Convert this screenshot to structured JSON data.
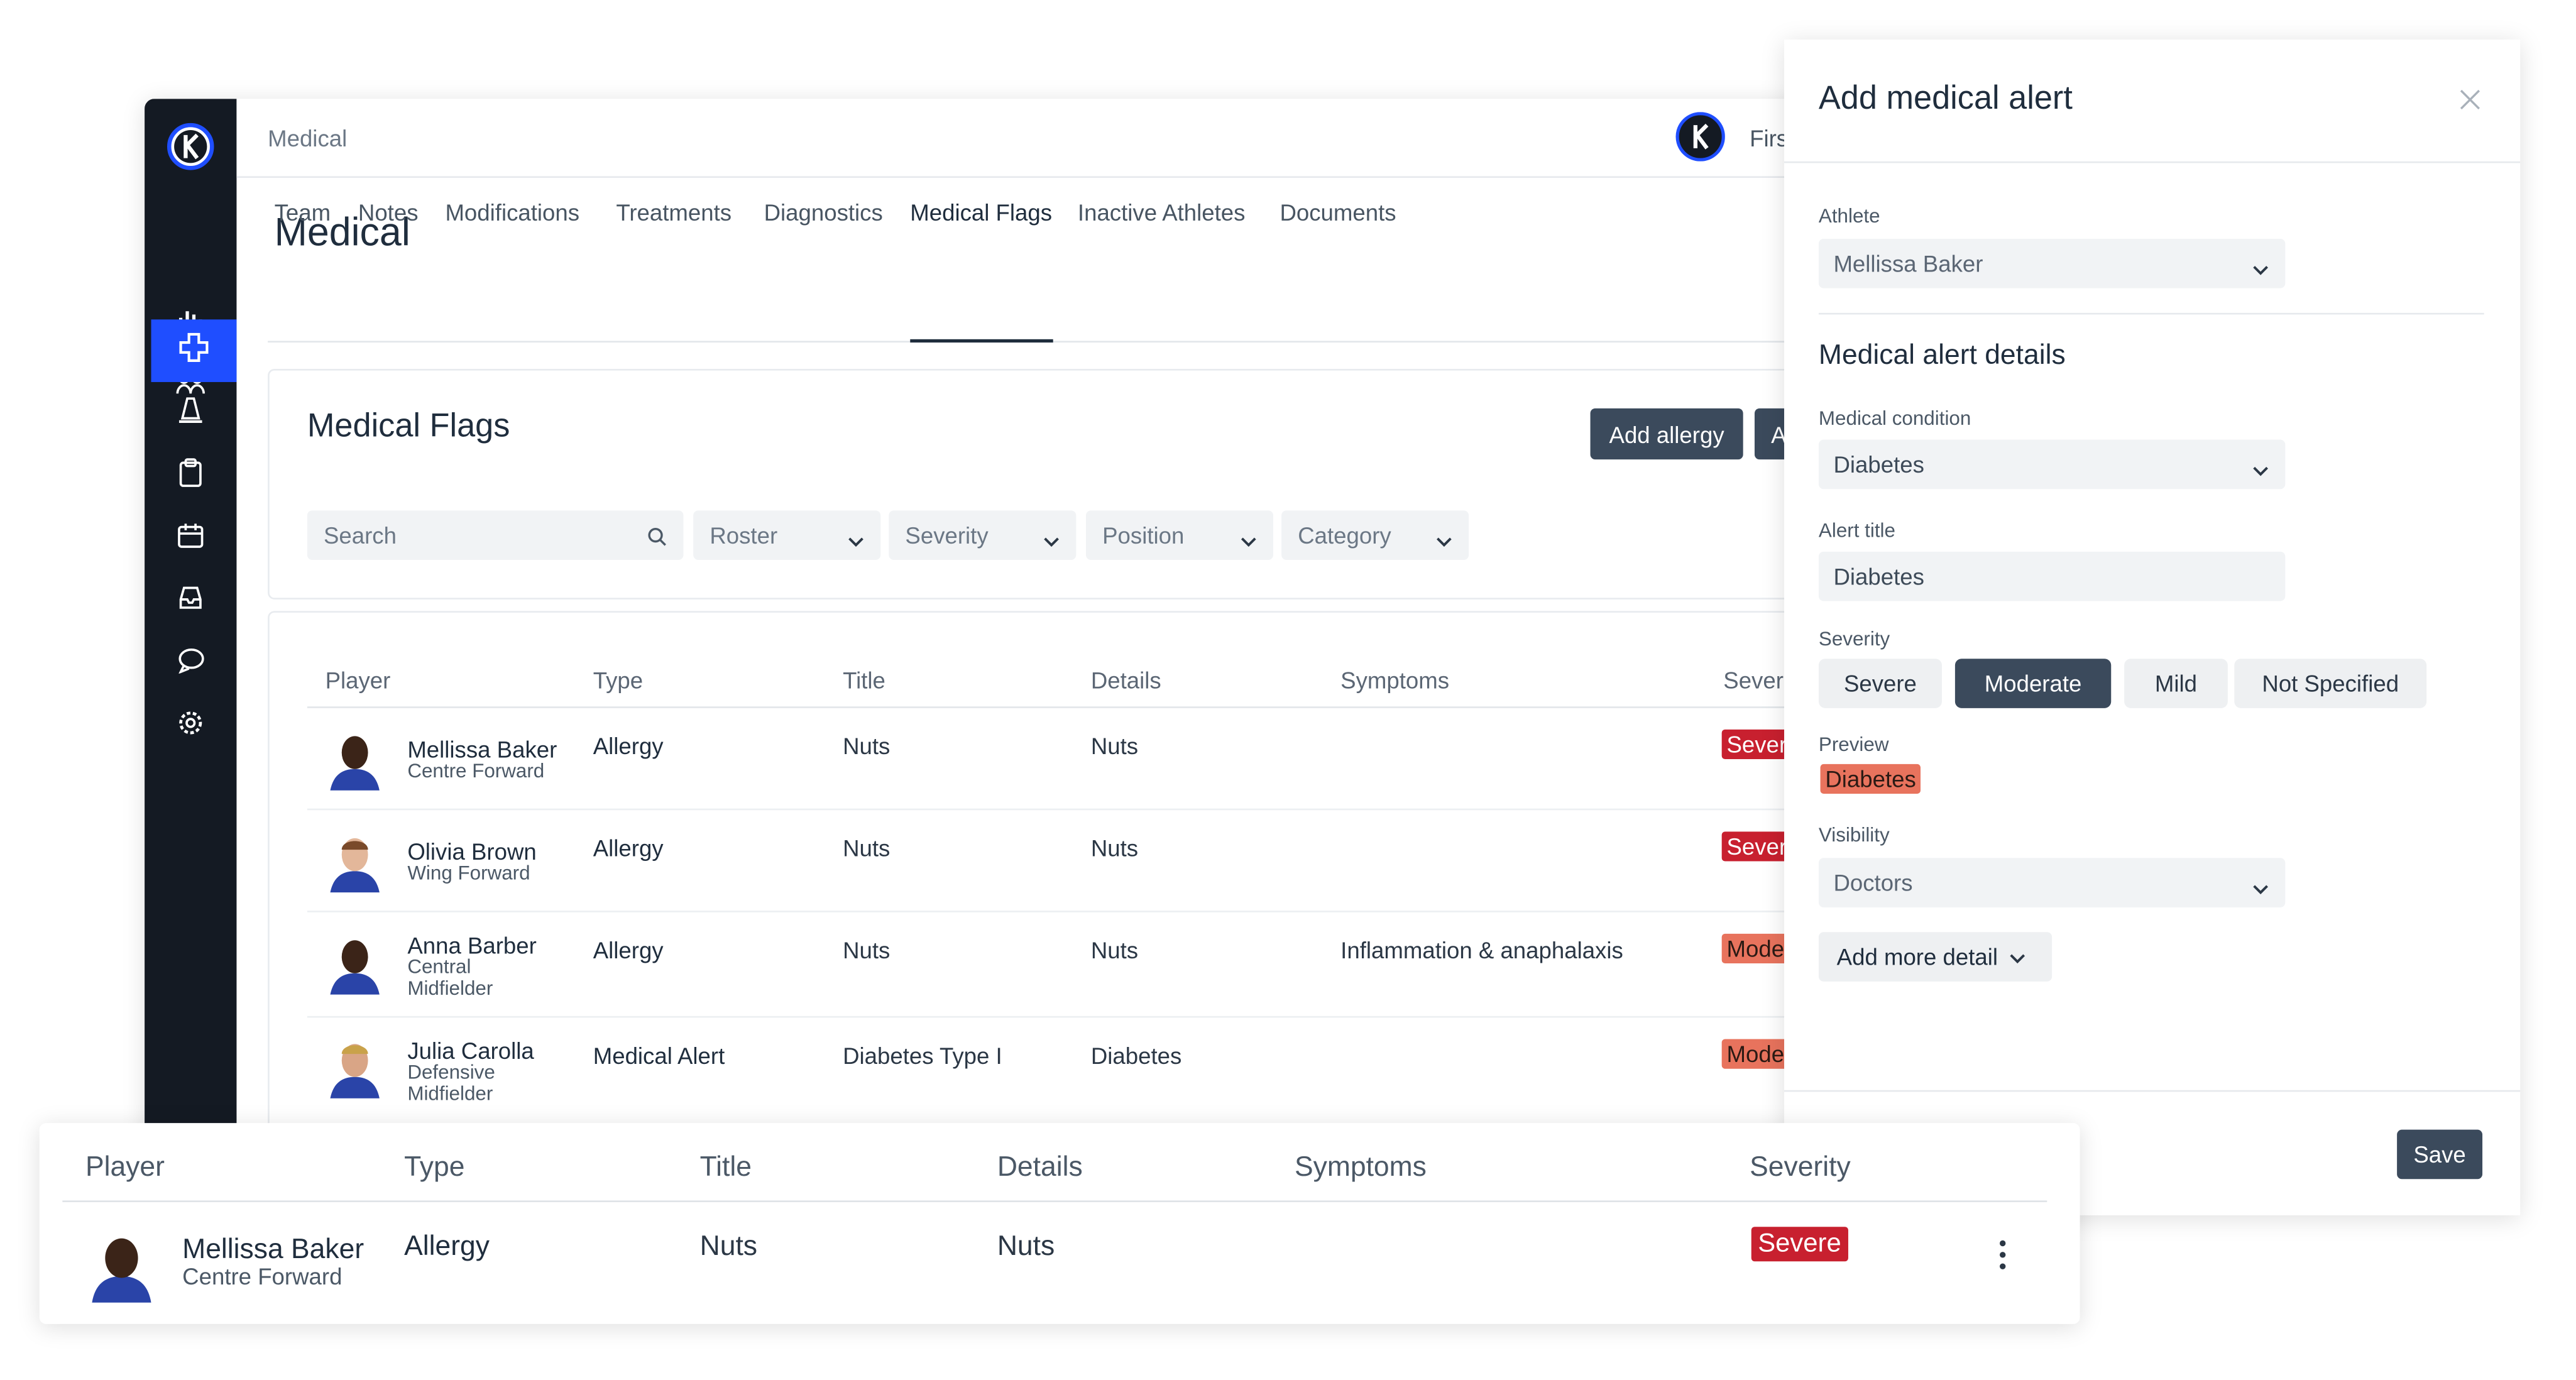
{
  "brand_colors": {
    "sidebar_bg": "#141a23",
    "active_accent": "#1f4eff",
    "severe": "#c8202f",
    "moderate": "#e8735d",
    "button_dark": "#3b4a5c"
  },
  "topbar": {
    "breadcrumb": "Medical",
    "user_name": "First"
  },
  "sidebar": {
    "items": [
      {
        "icon": "analytics-icon"
      },
      {
        "icon": "athletes-icon"
      },
      {
        "icon": "medical-cross-icon",
        "active": true
      },
      {
        "icon": "training-cone-icon"
      },
      {
        "icon": "clipboard-icon"
      },
      {
        "icon": "calendar-icon"
      },
      {
        "icon": "inbox-icon"
      },
      {
        "icon": "messages-icon"
      },
      {
        "icon": "settings-icon"
      }
    ]
  },
  "page": {
    "title": "Medical",
    "tabs": [
      {
        "label": "Team"
      },
      {
        "label": "Notes"
      },
      {
        "label": "Modifications"
      },
      {
        "label": "Treatments"
      },
      {
        "label": "Diagnostics"
      },
      {
        "label": "Medical Flags",
        "active": true
      },
      {
        "label": "Inactive Athletes"
      },
      {
        "label": "Documents"
      }
    ]
  },
  "flags": {
    "title": "Medical Flags",
    "add_allergy": "Add allergy",
    "add_alert_partial": "A",
    "filters": {
      "search_placeholder": "Search",
      "roster": "Roster",
      "severity": "Severity",
      "position": "Position",
      "category": "Category"
    },
    "columns": {
      "player": "Player",
      "type": "Type",
      "title": "Title",
      "details": "Details",
      "symptoms": "Symptoms",
      "severity": "Sever"
    },
    "rows": [
      {
        "name": "Mellissa Baker",
        "position": "Centre Forward",
        "type": "Allergy",
        "title": "Nuts",
        "details": "Nuts",
        "symptoms": "",
        "severity": "Sever"
      },
      {
        "name": "Olivia Brown",
        "position": "Wing Forward",
        "type": "Allergy",
        "title": "Nuts",
        "details": "Nuts",
        "symptoms": "",
        "severity": "Sever"
      },
      {
        "name": "Anna Barber",
        "position": "Central\nMidfielder",
        "type": "Allergy",
        "title": "Nuts",
        "details": "Nuts",
        "symptoms": "Inflammation & anaphalaxis",
        "severity": "Mode"
      },
      {
        "name": "Julia Carolla",
        "position": "Defensive\nMidfielder",
        "type": "Medical Alert",
        "title": "Diabetes Type I",
        "details": "Diabetes",
        "symptoms": "",
        "severity": "Mode"
      }
    ]
  },
  "drawer": {
    "title": "Add medical alert",
    "athlete_label": "Athlete",
    "athlete_value": "Mellissa Baker",
    "section_title": "Medical alert details",
    "condition_label": "Medical condition",
    "condition_value": "Diabetes",
    "alert_title_label": "Alert title",
    "alert_title_value": "Diabetes",
    "severity_label": "Severity",
    "severity_options": [
      {
        "label": "Severe"
      },
      {
        "label": "Moderate",
        "selected": true
      },
      {
        "label": "Mild"
      },
      {
        "label": "Not Specified"
      }
    ],
    "preview_label": "Preview",
    "preview_value": "Diabetes",
    "visibility_label": "Visibility",
    "visibility_value": "Doctors",
    "more_detail": "Add more detail",
    "save": "Save"
  },
  "highlight": {
    "columns": {
      "player": "Player",
      "type": "Type",
      "title": "Title",
      "details": "Details",
      "symptoms": "Symptoms",
      "severity": "Severity"
    },
    "row": {
      "name": "Mellissa Baker",
      "position": "Centre Forward",
      "type": "Allergy",
      "title": "Nuts",
      "details": "Nuts",
      "symptoms": "",
      "severity": "Severe"
    }
  }
}
